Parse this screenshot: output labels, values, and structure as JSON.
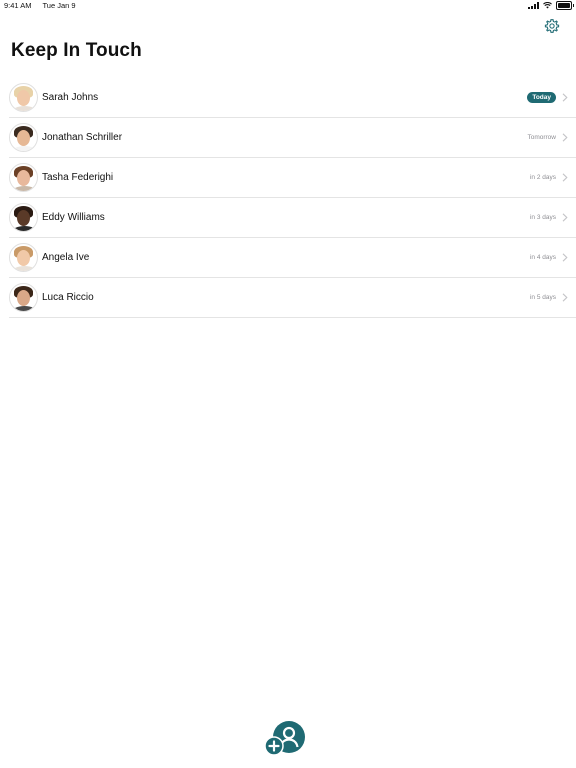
{
  "status_bar": {
    "time": "9:41 AM",
    "date": "Tue Jan 9",
    "battery_level": 1.0
  },
  "header": {
    "title": "Keep In Touch",
    "settings_icon": "gear-icon"
  },
  "contacts": [
    {
      "name": "Sarah Johns",
      "due": "Today",
      "highlight": true,
      "skin": "#f0c8a8",
      "hair": "#e8d2a8",
      "shirt": "#e8e0d8"
    },
    {
      "name": "Jonathan Schriller",
      "due": "Tomorrow",
      "highlight": false,
      "skin": "#e6b895",
      "hair": "#3a2a1f",
      "shirt": "#f4f4f4"
    },
    {
      "name": "Tasha Federighi",
      "due": "in 2 days",
      "highlight": false,
      "skin": "#e8b89c",
      "hair": "#6b4026",
      "shirt": "#c9b8a8"
    },
    {
      "name": "Eddy Williams",
      "due": "in 3 days",
      "highlight": false,
      "skin": "#5a3a28",
      "hair": "#2a1a12",
      "shirt": "#2a2a2a"
    },
    {
      "name": "Angela Ive",
      "due": "in 4 days",
      "highlight": false,
      "skin": "#f1c9a8",
      "hair": "#c99a68",
      "shirt": "#e9e2da"
    },
    {
      "name": "Luca Riccio",
      "due": "in 5 days",
      "highlight": false,
      "skin": "#d9a888",
      "hair": "#3b2618",
      "shirt": "#4b4b4b"
    }
  ],
  "fab": {
    "icon": "add-person-icon"
  },
  "colors": {
    "accent": "#1f6a73",
    "separator": "#e4e4e4",
    "secondary_text": "#8e8e93"
  }
}
